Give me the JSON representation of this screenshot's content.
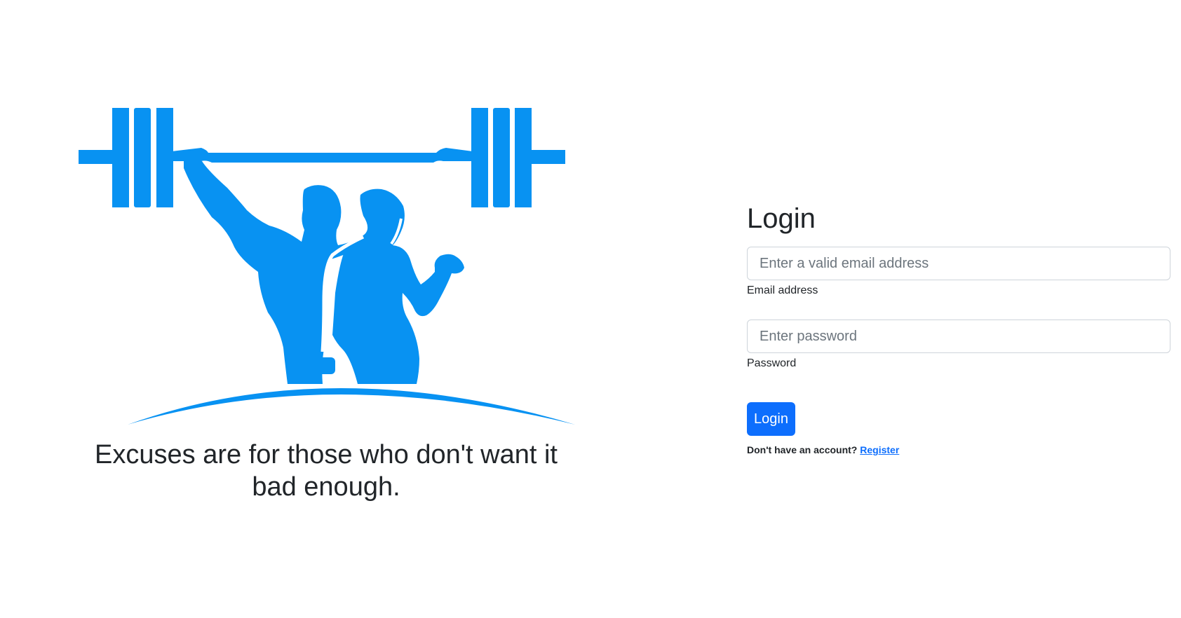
{
  "colors": {
    "brand": "#0892f2",
    "primary_button": "#0d6efd",
    "text": "#212529"
  },
  "hero": {
    "logo_icon": "weightlifting-couple-logo",
    "slogan": "Excuses are for those who don't want it bad enough."
  },
  "login": {
    "title": "Login",
    "email": {
      "placeholder": "Enter a valid email address",
      "value": "",
      "label": "Email address"
    },
    "password": {
      "placeholder": "Enter password",
      "value": "",
      "label": "Password"
    },
    "submit_label": "Login",
    "register_prompt": "Don't have an account?",
    "register_link": "Register"
  }
}
